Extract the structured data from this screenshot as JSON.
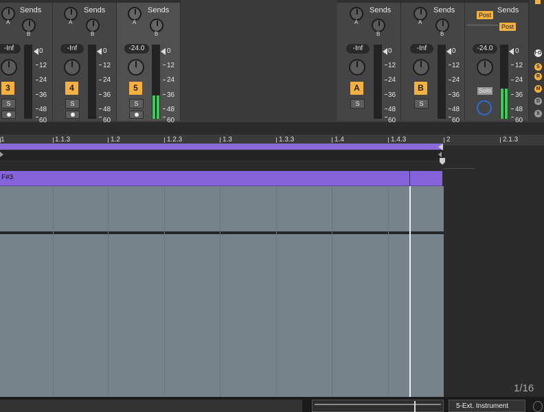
{
  "mixer": {
    "tracks": [
      {
        "number": "3",
        "volume": "-Inf",
        "sends_label": "Sends",
        "knob_a": "A",
        "knob_b": "B",
        "solo": "S"
      },
      {
        "number": "4",
        "volume": "-Inf",
        "sends_label": "Sends",
        "knob_a": "A",
        "knob_b": "B",
        "solo": "S"
      },
      {
        "number": "5",
        "volume": "-24.0",
        "sends_label": "Sends",
        "knob_a": "A",
        "knob_b": "B",
        "solo": "S"
      }
    ],
    "returns": [
      {
        "number": "A",
        "volume": "-Inf",
        "sends_label": "Sends",
        "knob_a": "A",
        "knob_b": "B",
        "solo": "S"
      },
      {
        "number": "B",
        "volume": "-Inf",
        "sends_label": "Sends",
        "knob_a": "A",
        "knob_b": "B",
        "solo": "S"
      }
    ],
    "master": {
      "volume": "-24.0",
      "sends_label": "Sends",
      "post_1": "Post",
      "post_2": "Post",
      "solo": "Solo"
    },
    "meter_scale": [
      "0",
      "12",
      "24",
      "36",
      "48",
      "60"
    ],
    "side_buttons": [
      "I·O",
      "S",
      "R",
      "M",
      "D",
      "X"
    ]
  },
  "arrangement": {
    "ruler": [
      "1",
      "1.1.3",
      "1.2",
      "1.2.3",
      "1.3",
      "1.3.3",
      "1.4",
      "1.4.3",
      "2",
      "2.1.3"
    ],
    "clip_name": "F#3",
    "grid_quantization": "1/16"
  },
  "bottom_bar": {
    "instrument": "5-Ext. Instrument"
  },
  "colors": {
    "accent": "#f5b042",
    "clip": "#8563da",
    "meter": "#36d054",
    "lane": "#77838b"
  }
}
